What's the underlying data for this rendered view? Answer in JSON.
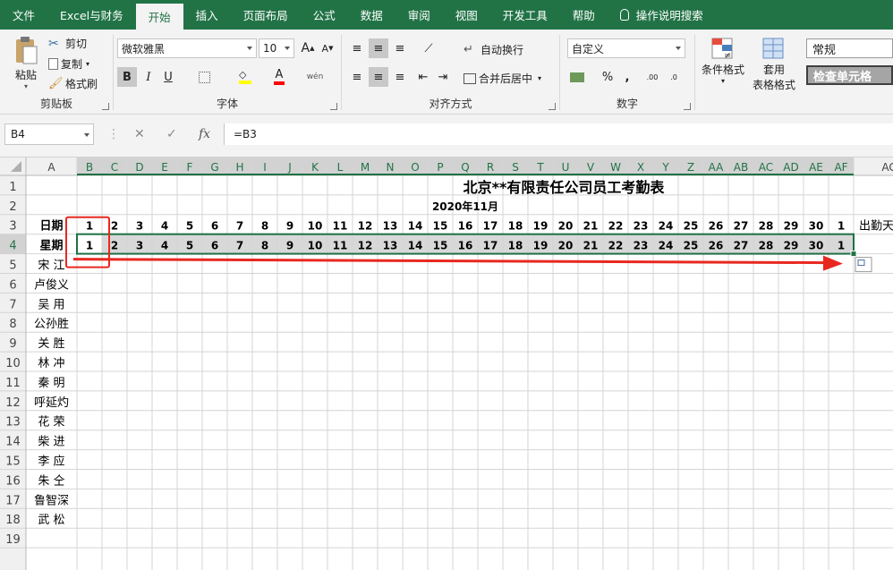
{
  "tabs": [
    "文件",
    "Excel与财务",
    "开始",
    "插入",
    "页面布局",
    "公式",
    "数据",
    "审阅",
    "视图",
    "开发工具",
    "帮助",
    "操作说明搜索"
  ],
  "active_tab": "开始",
  "clipboard": {
    "paste": "粘贴",
    "cut": "剪切",
    "copy": "复制",
    "format_painter": "格式刷",
    "label": "剪贴板"
  },
  "font": {
    "name": "微软雅黑",
    "size": "10",
    "bold": "B",
    "italic": "I",
    "underline": "U",
    "font_color_letter": "A",
    "phonetic": "wén",
    "label": "字体",
    "grow": "A",
    "shrink": "A"
  },
  "alignment": {
    "wrap": "自动换行",
    "merge": "合并后居中",
    "label": "对齐方式"
  },
  "number": {
    "format": "自定义",
    "percent": "%",
    "comma": ",",
    "inc": ".00",
    "dec": ".0",
    "label": "数字"
  },
  "styles": {
    "cond": "条件格式",
    "table_line1": "套用",
    "table_line2": "表格格式",
    "normal": "常规",
    "check": "检查单元格"
  },
  "namebox": "B4",
  "formula": "=B3",
  "formula_symbols": {
    "cancel": "✕",
    "enter": "✓",
    "fx": "fx"
  },
  "colors": {
    "excel_green": "#217346",
    "header_sel_text": "#217346",
    "selection": "#1e7145",
    "arrow": "#e8281f"
  },
  "sheet": {
    "columns": [
      "A",
      "B",
      "C",
      "D",
      "E",
      "F",
      "G",
      "H",
      "I",
      "J",
      "K",
      "L",
      "M",
      "N",
      "O",
      "P",
      "Q",
      "R",
      "S",
      "T",
      "U",
      "V",
      "W",
      "X",
      "Y",
      "Z",
      "AA",
      "AB",
      "AC",
      "AD",
      "AE",
      "AF",
      "AG"
    ],
    "rows": [
      "1",
      "2",
      "3",
      "4",
      "5",
      "6",
      "7",
      "8",
      "9",
      "10",
      "11",
      "12",
      "13",
      "14",
      "15",
      "16",
      "17",
      "18",
      "19"
    ],
    "title": "北京**有限责任公司员工考勤表",
    "month": "2020年11月",
    "row3_label": "日期",
    "row4_label": "星期",
    "days": [
      "1",
      "2",
      "3",
      "4",
      "5",
      "6",
      "7",
      "8",
      "9",
      "10",
      "11",
      "12",
      "13",
      "14",
      "15",
      "16",
      "17",
      "18",
      "19",
      "20",
      "21",
      "22",
      "23",
      "24",
      "25",
      "26",
      "27",
      "28",
      "29",
      "30",
      "1"
    ],
    "weekdays": [
      "1",
      "2",
      "3",
      "4",
      "5",
      "6",
      "7",
      "8",
      "9",
      "10",
      "11",
      "12",
      "13",
      "14",
      "15",
      "16",
      "17",
      "18",
      "19",
      "20",
      "21",
      "22",
      "23",
      "24",
      "25",
      "26",
      "27",
      "28",
      "29",
      "30",
      "1"
    ],
    "attendance_header": "出勤天",
    "names": [
      "宋 江",
      "卢俊义",
      "吴 用",
      "公孙胜",
      "关 胜",
      "林 冲",
      "秦 明",
      "呼延灼",
      "花 荣",
      "柴 进",
      "李 应",
      "朱 仝",
      "鲁智深",
      "武 松"
    ]
  }
}
